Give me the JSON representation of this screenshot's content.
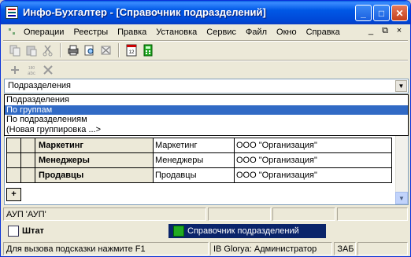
{
  "window": {
    "title": "Инфо-Бухгалтер - [Справочник подразделений]",
    "minimize": "_",
    "maximize": "□",
    "close": "✕"
  },
  "menubar": {
    "items": [
      "Операции",
      "Реестры",
      "Правка",
      "Установка",
      "Сервис",
      "Файл",
      "Окно",
      "Справка"
    ],
    "mdi_minimize": "_",
    "mdi_restore": "⧉",
    "mdi_close": "×"
  },
  "toolbar": {
    "icon_date_label": "1\n2MB"
  },
  "combo": {
    "value": "Подразделения",
    "arrow": "▼"
  },
  "dropdown": {
    "options": [
      "Подразделения",
      "По группам",
      "По подразделениям",
      "(Новая группировка ...>"
    ],
    "selected_index": 1
  },
  "grid": {
    "rows": [
      {
        "name": "Маркетинг",
        "short": "Маркетинг",
        "org": "ООО \"Организация\""
      },
      {
        "name": "Менеджеры",
        "short": "Менеджеры",
        "org": "ООО \"Организация\""
      },
      {
        "name": "Продавцы",
        "short": "Продавцы",
        "org": "ООО \"Организация\""
      }
    ],
    "add_label": "+"
  },
  "panels": {
    "left": "АУП 'АУП'"
  },
  "taskbar": {
    "tasks": [
      "Штат",
      "Справочник подразделений"
    ],
    "active_index": 1
  },
  "statusbar": {
    "hint": "Для вызова подсказки нажмите F1",
    "db": "IB Glorya: Администратор",
    "kb": "ЗАБ"
  }
}
